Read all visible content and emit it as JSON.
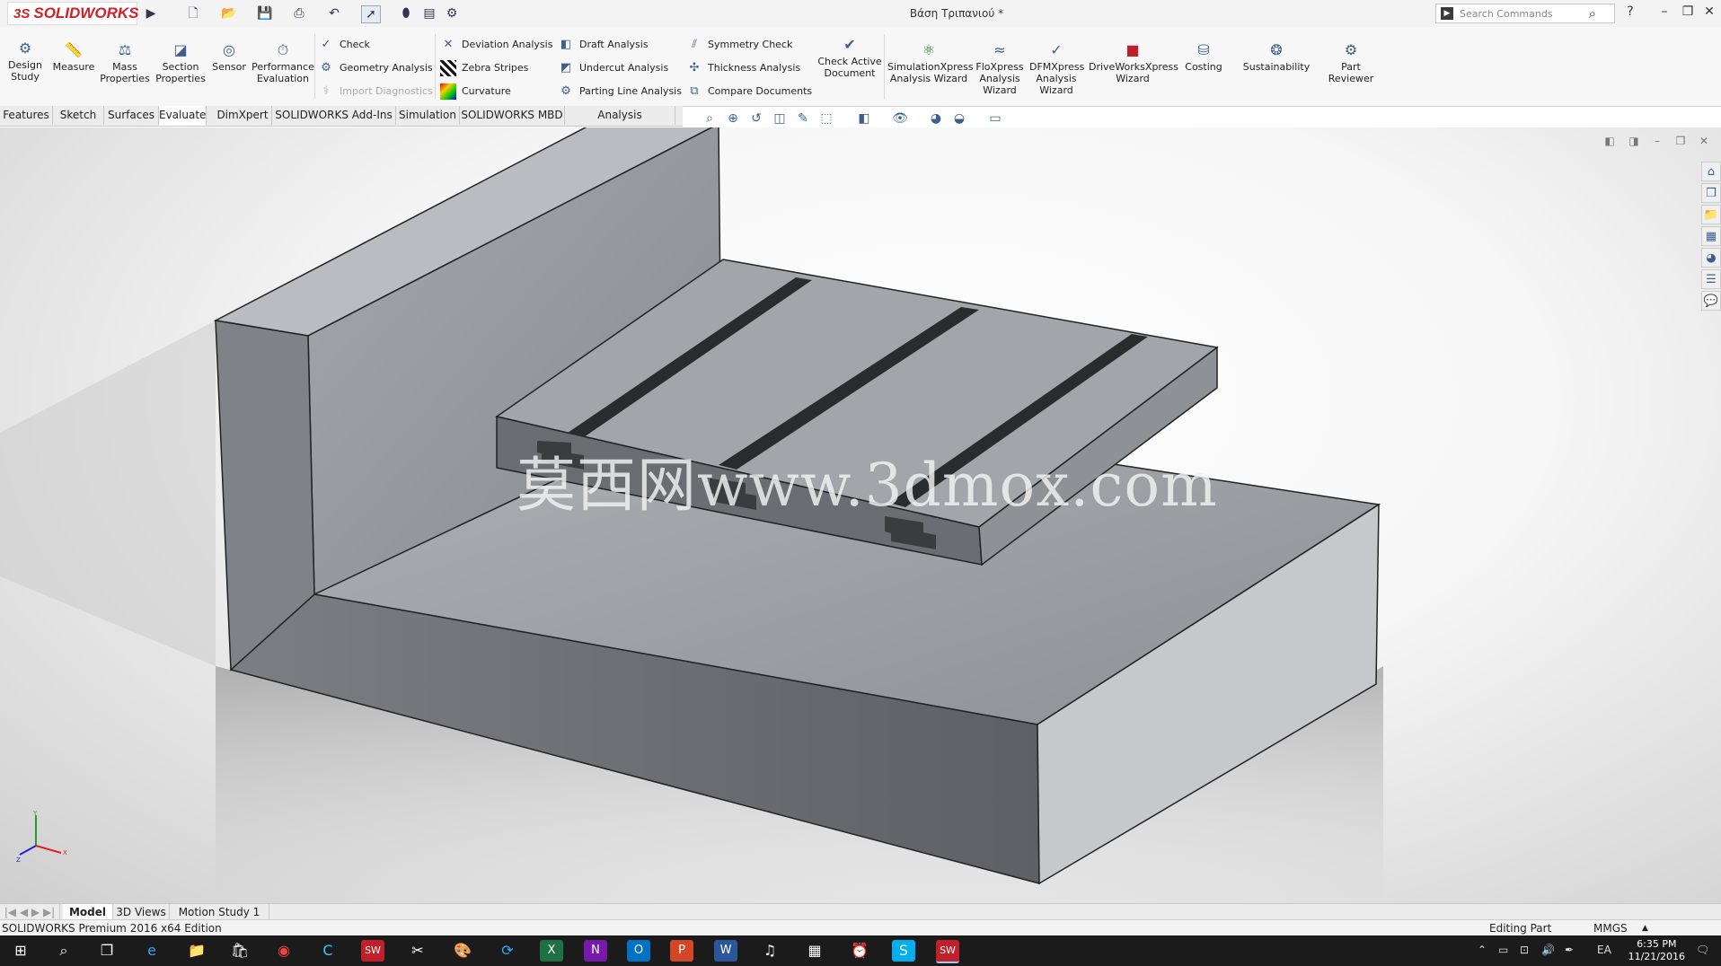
{
  "app": {
    "logo": "SOLIDWORKS",
    "logo_prefix": "3S",
    "document_title": "Βάση Τριπανιού *",
    "search_placeholder": "Search Commands"
  },
  "commands": {
    "design_study": "Design Study",
    "measure": "Measure",
    "mass_properties": "Mass Properties",
    "section_properties": "Section Properties",
    "sensor": "Sensor",
    "performance_evaluation": "Performance Evaluation",
    "check": "Check",
    "geometry_analysis": "Geometry Analysis",
    "import_diagnostics": "Import Diagnostics",
    "deviation_analysis": "Deviation Analysis",
    "zebra_stripes": "Zebra Stripes",
    "curvature": "Curvature",
    "draft_analysis": "Draft Analysis",
    "undercut_analysis": "Undercut Analysis",
    "parting_line_analysis": "Parting Line Analysis",
    "symmetry_check": "Symmetry Check",
    "thickness_analysis": "Thickness Analysis",
    "compare_documents": "Compare Documents",
    "check_active_document": "Check Active Document",
    "simulationxpress": "SimulationXpress Analysis Wizard",
    "floxpress": "FloXpress Analysis Wizard",
    "dfmxpress": "DFMXpress Analysis Wizard",
    "driveworksxpress": "DriveWorksXpress Wizard",
    "costing": "Costing",
    "sustainability": "Sustainability",
    "part_reviewer": "Part Reviewer"
  },
  "tabs": [
    "Features",
    "Sketch",
    "Surfaces",
    "Evaluate",
    "DimXpert",
    "SOLIDWORKS Add-Ins",
    "Simulation",
    "SOLIDWORKS MBD",
    "Analysis Preparation"
  ],
  "active_tab": "Evaluate",
  "watermark": "莫西网www.3dmox.com",
  "model_tabs": [
    "Model",
    "3D Views",
    "Motion Study 1"
  ],
  "status": {
    "edition": "SOLIDWORKS Premium 2016 x64 Edition",
    "mode": "Editing Part",
    "units": "MMGS"
  },
  "taskbar": {
    "lang": "EA",
    "time": "6:35 PM",
    "date": "11/21/2016"
  },
  "colors": {
    "brand_red": "#d0202a",
    "model_face_top": "#9b9ea3",
    "model_face_dark": "#6c6f74"
  }
}
